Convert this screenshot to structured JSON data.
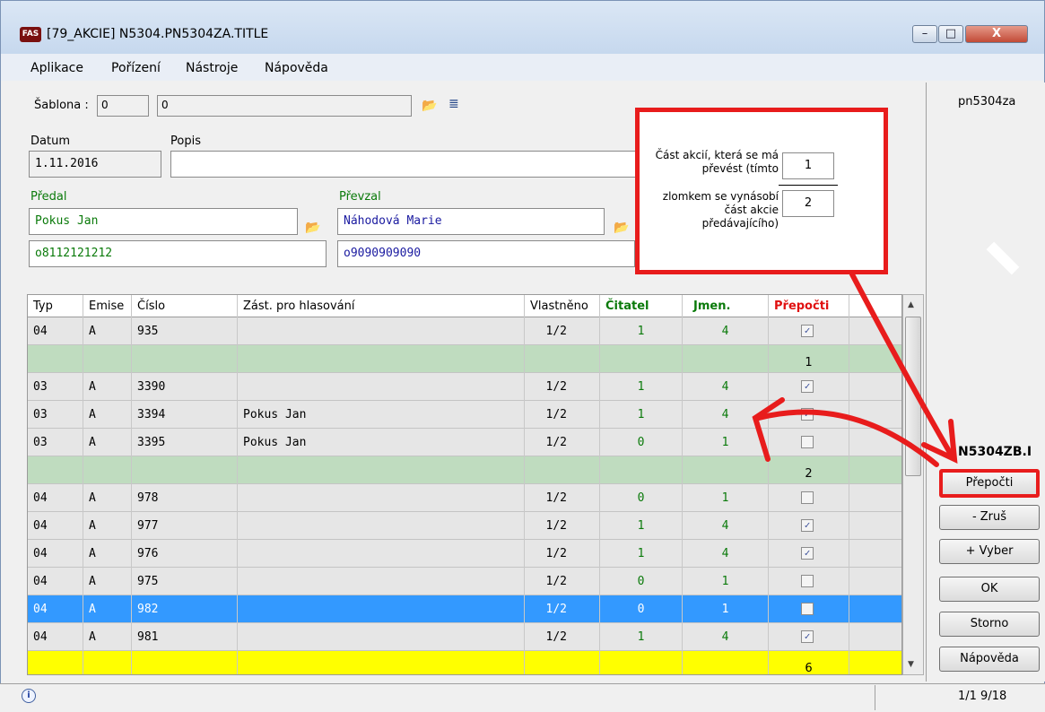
{
  "window": {
    "title": "[79_AKCIE] N5304.PN5304ZA.TITLE",
    "logo": "FAS",
    "caption_buttons": {
      "minimize": "–",
      "maximize": "□",
      "close": "X"
    }
  },
  "menu": [
    "Aplikace",
    "Pořízení",
    "Nástroje",
    "Nápověda"
  ],
  "form": {
    "sablona_label": "Šablona :",
    "sablona_code": "0",
    "sablona_name": "0",
    "datum_label": "Datum",
    "datum_value": "1.11.2016",
    "popis_label": "Popis",
    "popis_value": "",
    "predal_label": "Předal",
    "predal_name": "Pokus Jan",
    "predal_id": "o8112121212",
    "prevzal_label": "Převzal",
    "prevzal_name": "Náhodová Marie",
    "prevzal_id": "o9090909090"
  },
  "annotation": {
    "text_top": "Část akcií, která se má převést (tímto",
    "text_bottom": "zlomkem se vynásobí část akcie předávajícího)",
    "numerator": "1",
    "denominator": "2"
  },
  "table": {
    "headers": {
      "typ": "Typ",
      "emise": "Emise",
      "cislo": "Číslo",
      "zast": "Zást. pro hlasování",
      "vlastneno": "Vlastněno",
      "citatel": "Čitatel",
      "jmen": "Jmen.",
      "prepocti": "Přepočti"
    },
    "rows": [
      {
        "typ": "04",
        "emise": "A",
        "cislo": "935",
        "zast": "",
        "vlastneno": "1/2",
        "citatel": "1",
        "jmen": "4",
        "check": "✓",
        "kind": "normal"
      },
      {
        "typ": "",
        "emise": "",
        "cislo": "",
        "zast": "",
        "vlastneno": "",
        "citatel": "",
        "jmen": "",
        "sum": "1",
        "kind": "group"
      },
      {
        "typ": "03",
        "emise": "A",
        "cislo": "3390",
        "zast": "",
        "vlastneno": "1/2",
        "citatel": "1",
        "jmen": "4",
        "check": "✓",
        "kind": "normal"
      },
      {
        "typ": "03",
        "emise": "A",
        "cislo": "3394",
        "zast": "Pokus Jan",
        "vlastneno": "1/2",
        "citatel": "1",
        "jmen": "4",
        "check": "✓",
        "kind": "normal"
      },
      {
        "typ": "03",
        "emise": "A",
        "cislo": "3395",
        "zast": "Pokus Jan",
        "vlastneno": "1/2",
        "citatel": "0",
        "jmen": "1",
        "check": "",
        "kind": "normal"
      },
      {
        "typ": "",
        "emise": "",
        "cislo": "",
        "zast": "",
        "vlastneno": "",
        "citatel": "",
        "jmen": "",
        "sum": "2",
        "kind": "group"
      },
      {
        "typ": "04",
        "emise": "A",
        "cislo": "978",
        "zast": "",
        "vlastneno": "1/2",
        "citatel": "0",
        "jmen": "1",
        "check": "",
        "kind": "normal"
      },
      {
        "typ": "04",
        "emise": "A",
        "cislo": "977",
        "zast": "",
        "vlastneno": "1/2",
        "citatel": "1",
        "jmen": "4",
        "check": "✓",
        "kind": "normal"
      },
      {
        "typ": "04",
        "emise": "A",
        "cislo": "976",
        "zast": "",
        "vlastneno": "1/2",
        "citatel": "1",
        "jmen": "4",
        "check": "✓",
        "kind": "normal"
      },
      {
        "typ": "04",
        "emise": "A",
        "cislo": "975",
        "zast": "",
        "vlastneno": "1/2",
        "citatel": "0",
        "jmen": "1",
        "check": "",
        "kind": "normal"
      },
      {
        "typ": "04",
        "emise": "A",
        "cislo": "982",
        "zast": "",
        "vlastneno": "1/2",
        "citatel": "0",
        "jmen": "1",
        "check": "",
        "kind": "selected"
      },
      {
        "typ": "04",
        "emise": "A",
        "cislo": "981",
        "zast": "",
        "vlastneno": "1/2",
        "citatel": "1",
        "jmen": "4",
        "check": "✓",
        "kind": "normal"
      },
      {
        "typ": "",
        "emise": "",
        "cislo": "",
        "zast": "",
        "vlastneno": "",
        "citatel": "",
        "jmen": "",
        "sum": "6",
        "kind": "total"
      }
    ]
  },
  "right_panel": {
    "form_code": "pn5304za",
    "next_form": "N5304ZB.I",
    "buttons": {
      "prepocti": "Přepočti",
      "zrus": "- Zruš",
      "vyber": "+ Vyber",
      "ok": "OK",
      "storno": "Storno",
      "napoveda": "Nápověda"
    }
  },
  "status": {
    "info_icon": "i",
    "pages": "1/1  9/18"
  },
  "colors": {
    "group_row": "#bfdcbf",
    "total_row": "#ffff00",
    "selected_row": "#3399ff",
    "annotation": "#e81c1c",
    "green_text": "#0a7a0a",
    "red_header": "#e01010"
  }
}
